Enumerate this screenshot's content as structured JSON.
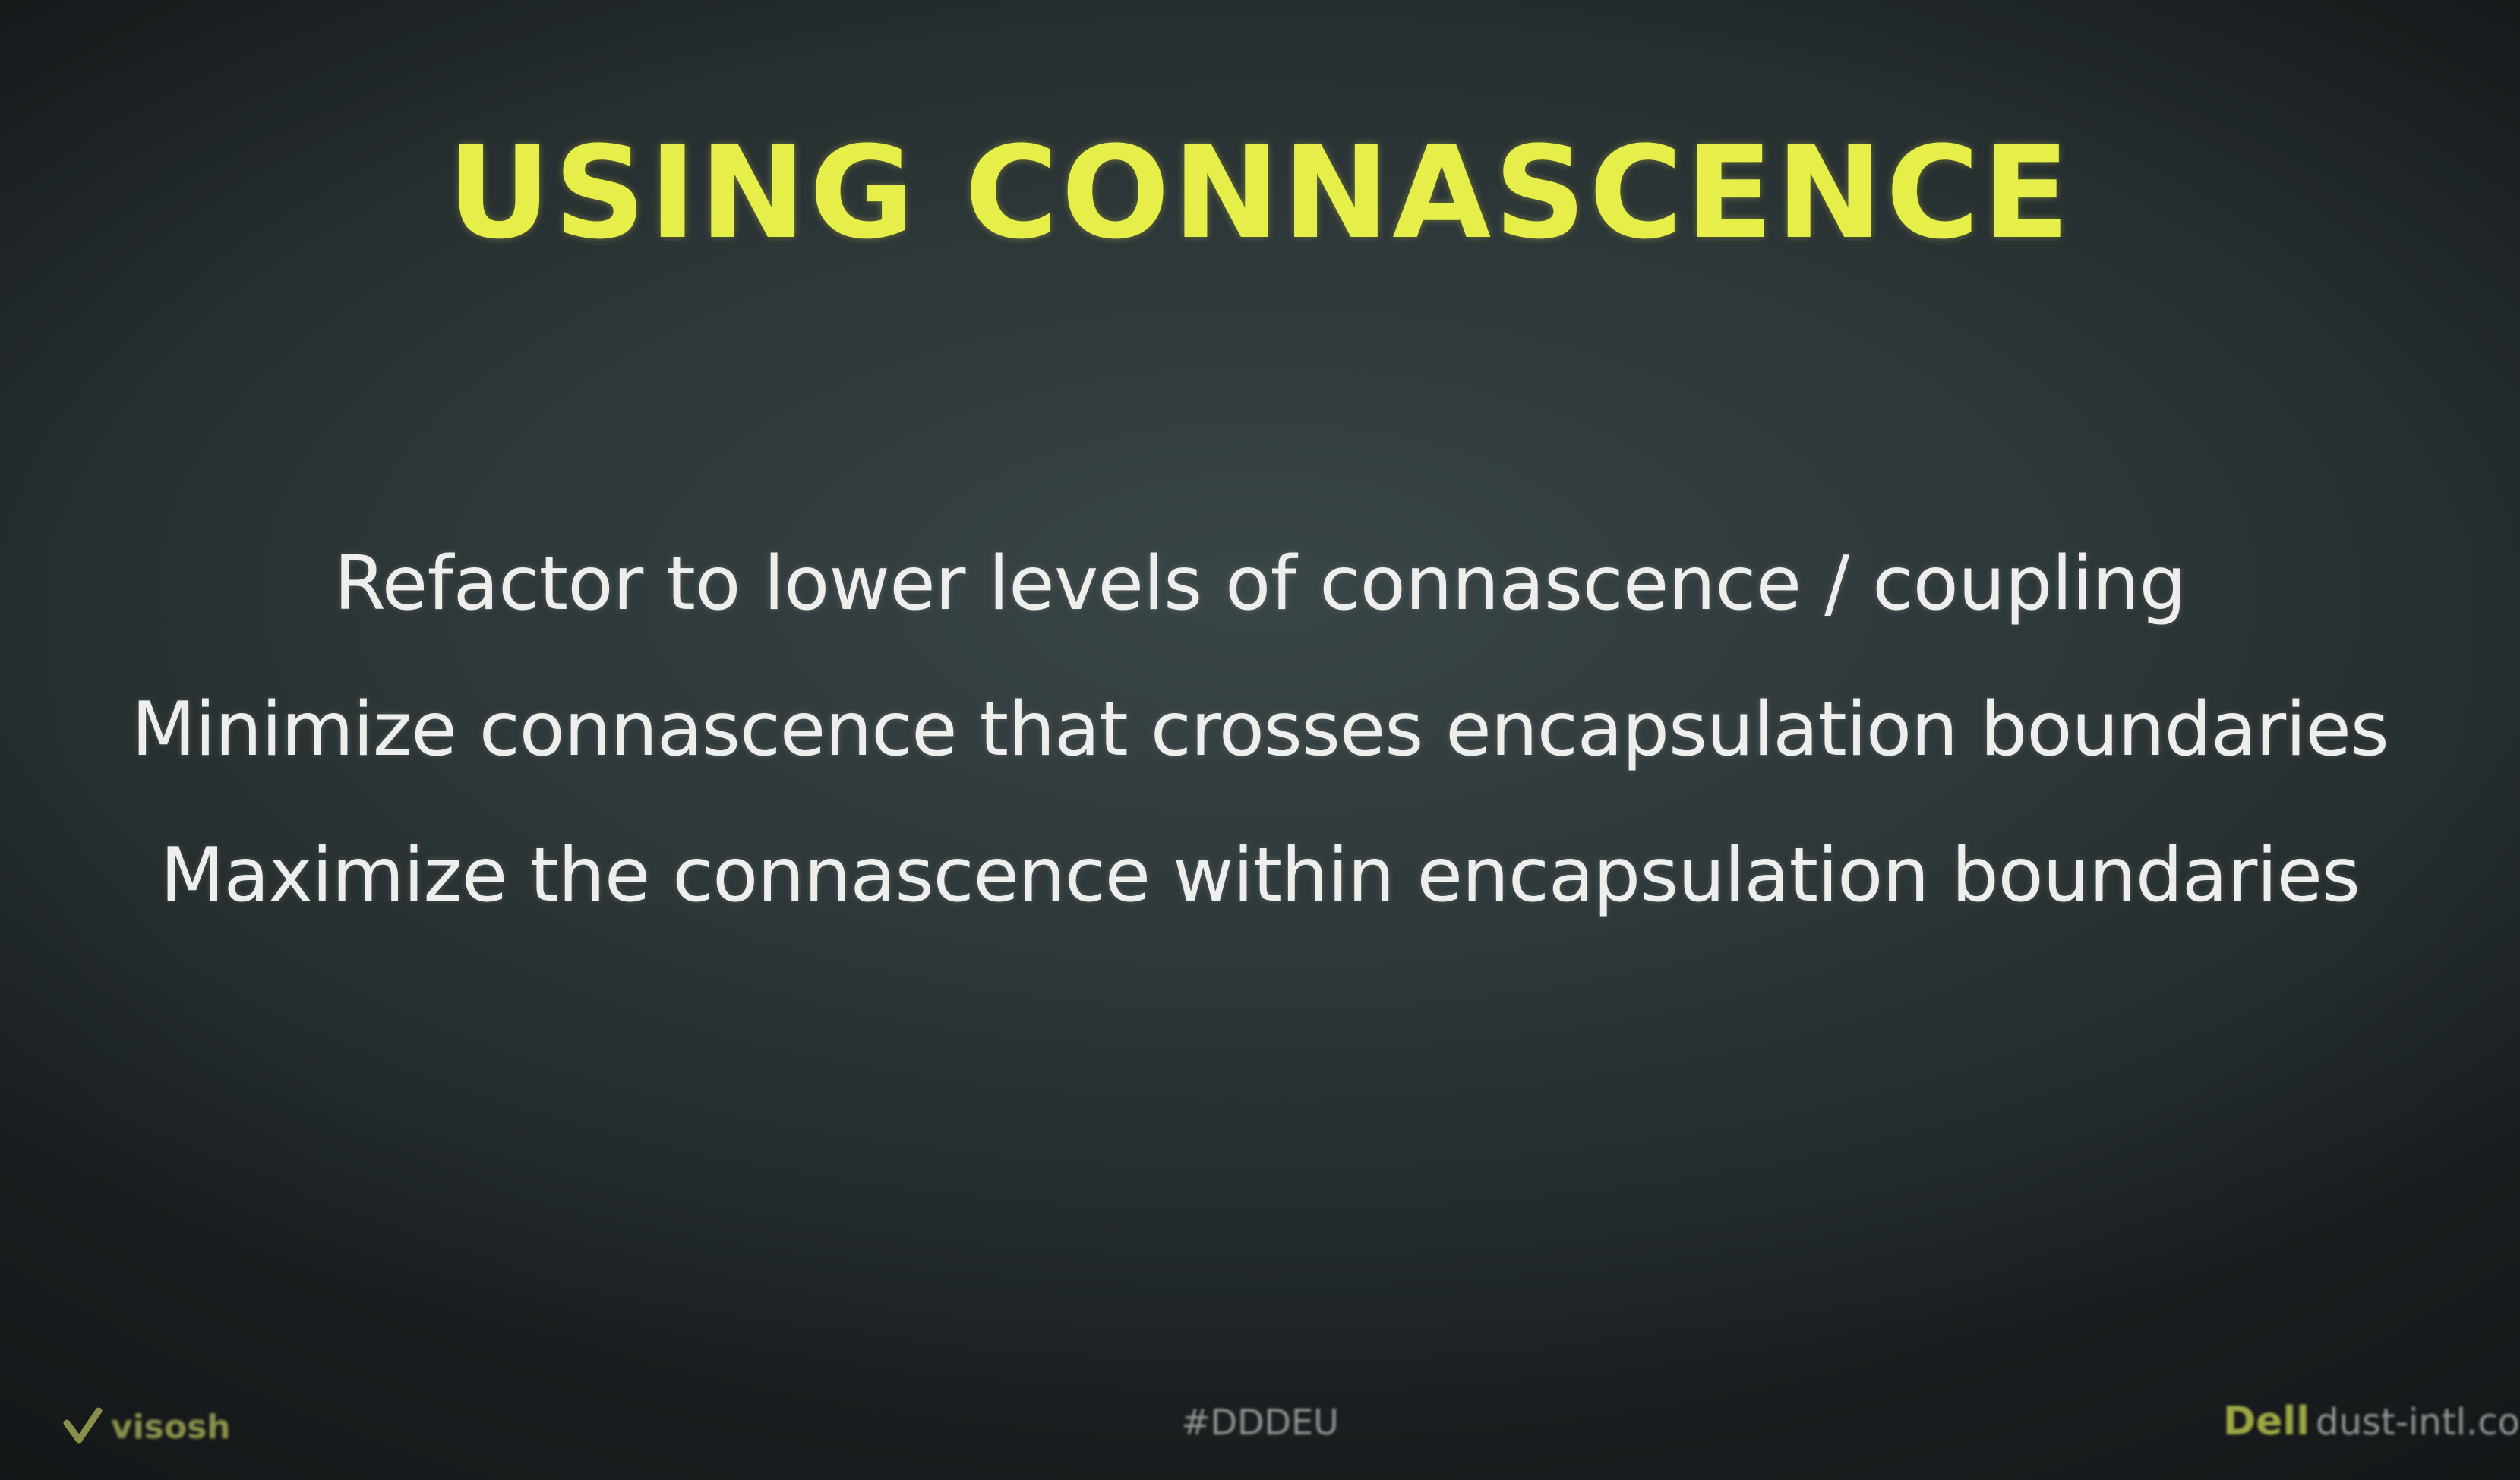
{
  "slide": {
    "title": "USING CONNASCENCE",
    "bullets": [
      "Refactor to lower levels of connascence / coupling",
      "Minimize connascence that crosses encapsulation boundaries",
      "Maximize the connascence within encapsulation boundaries"
    ]
  },
  "footer": {
    "left_logo_text": "visosh",
    "center_hashtag": "#DDDEU",
    "right_brand": "Dell",
    "right_text": "dust-intl.co"
  },
  "colors": {
    "title": "#e6ee4a",
    "body_text": "#eeeeec",
    "background": "#2e3739"
  }
}
